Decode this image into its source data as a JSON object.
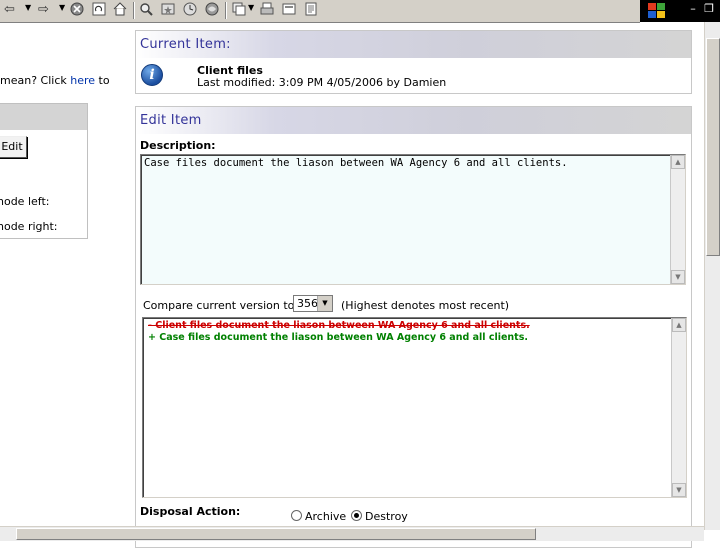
{
  "toolbar": {
    "buttons": [
      "back-icon",
      "forward-icon",
      "stop-icon",
      "refresh-icon",
      "home-icon",
      "search-icon",
      "favorites-icon",
      "history-icon",
      "media-icon",
      "mail-icon",
      "print-icon",
      "edit-page-icon",
      "discuss-icon"
    ]
  },
  "left": {
    "prompt_prefix": "mean? Click ",
    "prompt_link": "here",
    "prompt_suffix": " to",
    "edit_button": "Edit",
    "node_left": "node left:",
    "node_right": "node right:"
  },
  "current_item": {
    "header": "Current Item:",
    "name": "Client files",
    "modified": "Last modified: 3:09 PM 4/05/2006 by Damien"
  },
  "edit_item": {
    "header": "Edit Item",
    "description_label": "Description:",
    "description_value": "Case files document the liason between WA Agency 6 and all clients.",
    "compare_label": "Compare current version to:",
    "compare_value": "356",
    "compare_note": "(Highest denotes most recent)",
    "diff_removed": "- Client files document the liason between WA Agency 6 and all clients.",
    "diff_added": "+ Case files document the liason between WA Agency 6 and all clients.",
    "disposal_label": "Disposal Action:",
    "disposal_options": [
      "Archive",
      "Destroy"
    ],
    "disposal_selected": "Destroy"
  },
  "colors": {
    "header_text": "#333399",
    "diff_removed": "#cc0000",
    "diff_added": "#008000",
    "textarea_bg": "#f3fcfc"
  }
}
